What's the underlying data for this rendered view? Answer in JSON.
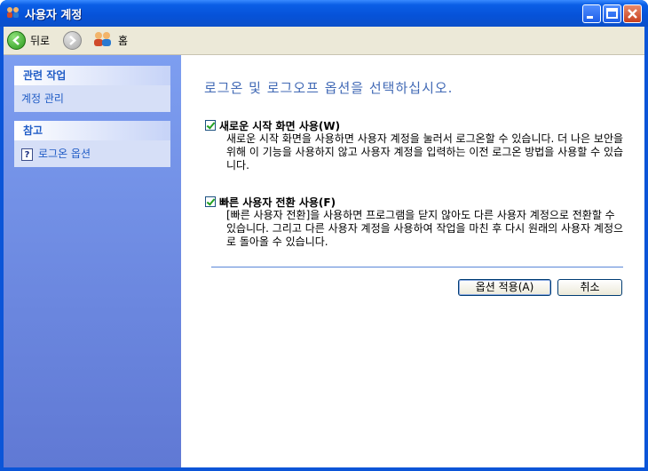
{
  "window": {
    "title": "사용자 계정"
  },
  "toolbar": {
    "back_label": "뒤로",
    "home_label": "홈"
  },
  "sidebar": {
    "related_header": "관련 작업",
    "related_items": [
      "계정 관리"
    ],
    "see_also_header": "참고",
    "see_also_items": [
      "로그온 옵션"
    ]
  },
  "main": {
    "title": "로그온 및 로그오프 옵션을 선택하십시오.",
    "option1": {
      "label": "새로운 시작 화면 사용(W)",
      "checked": true,
      "description": "새로운 시작 화면을 사용하면 사용자 계정을 눌러서 로그온할 수 있습니다. 더 나은 보안을 위해 이 기능을 사용하지 않고 사용자 계정을 입력하는 이전 로그온 방법을 사용할 수 있습니다."
    },
    "option2": {
      "label": "빠른 사용자 전환 사용(F)",
      "checked": true,
      "description": "[빠른 사용자 전환]을 사용하면 프로그램을 닫지 않아도 다른 사용자 계정으로 전환할 수 있습니다. 그리고 다른 사용자 계정을 사용하여 작업을 마친 후 다시 원래의 사용자 계정으로 돌아올 수 있습니다."
    },
    "apply_button": "옵션 적용(A)",
    "cancel_button": "취소"
  },
  "colors": {
    "titlebar": "#0652d8",
    "sidebar": "#6b87df",
    "link": "#215dc6",
    "heading": "#4169b5"
  }
}
